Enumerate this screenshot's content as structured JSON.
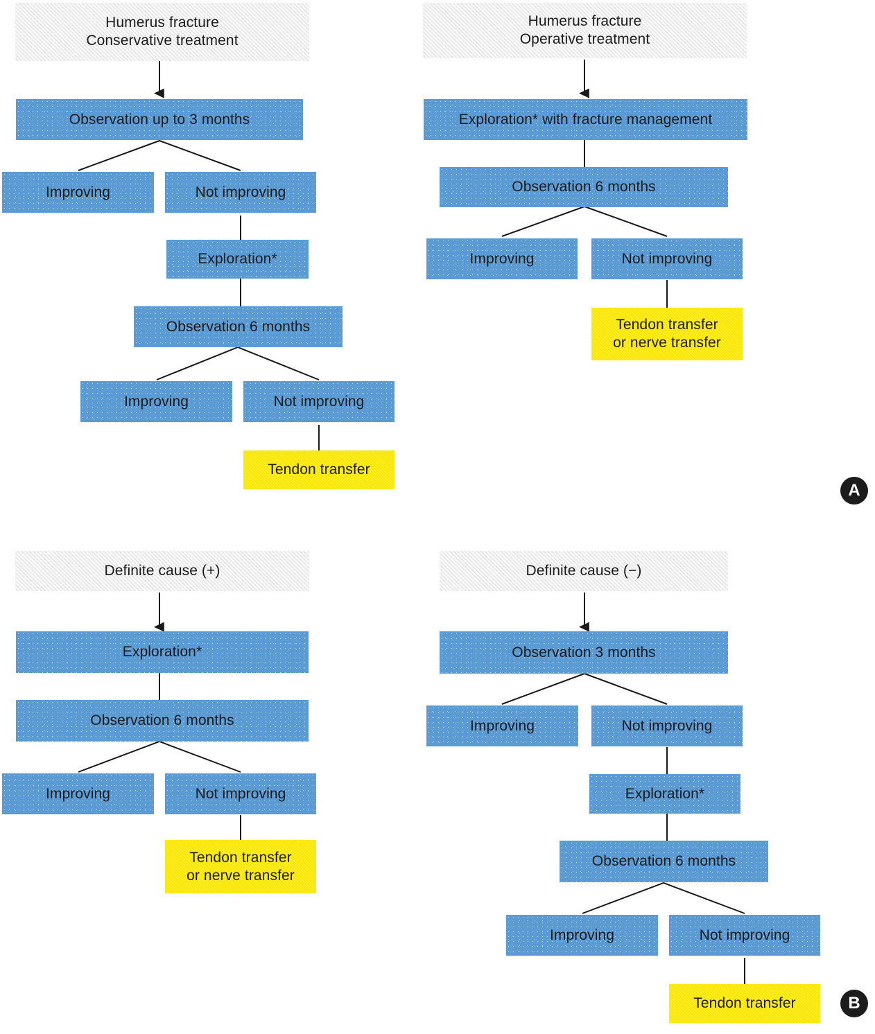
{
  "figure": {
    "panels": [
      {
        "tag": "A",
        "charts": [
          {
            "id": "a-left",
            "title": "Humerus fracture\nConservative treatment",
            "nodes": [
              {
                "id": "a1",
                "text": "Humerus fracture\nConservative treatment",
                "type": "header"
              },
              {
                "id": "a2",
                "text": "Observation up to 3 months",
                "type": "process"
              },
              {
                "id": "a3",
                "text": "Improving",
                "type": "process"
              },
              {
                "id": "a4",
                "text": "Not improving",
                "type": "process"
              },
              {
                "id": "a5",
                "text": "Exploration*",
                "type": "process"
              },
              {
                "id": "a6",
                "text": "Observation 6 months",
                "type": "process"
              },
              {
                "id": "a7",
                "text": "Improving",
                "type": "process"
              },
              {
                "id": "a8",
                "text": "Not improving",
                "type": "process"
              },
              {
                "id": "a9",
                "text": "Tendon transfer",
                "type": "outcome"
              }
            ]
          },
          {
            "id": "a-right",
            "title": "Humerus fracture\nOperative treatment",
            "nodes": [
              {
                "id": "b1",
                "text": "Humerus fracture\nOperative treatment",
                "type": "header"
              },
              {
                "id": "b2",
                "text": "Exploration* with fracture management",
                "type": "process"
              },
              {
                "id": "b3",
                "text": "Observation 6 months",
                "type": "process"
              },
              {
                "id": "b4",
                "text": "Improving",
                "type": "process"
              },
              {
                "id": "b5",
                "text": "Not improving",
                "type": "process"
              },
              {
                "id": "b6",
                "text": "Tendon transfer\nor nerve transfer",
                "type": "outcome"
              }
            ]
          }
        ]
      },
      {
        "tag": "B",
        "charts": [
          {
            "id": "b-left",
            "title": "Definite cause (+)",
            "nodes": [
              {
                "id": "c1",
                "text": "Definite cause (+)",
                "type": "header"
              },
              {
                "id": "c2",
                "text": "Exploration*",
                "type": "process"
              },
              {
                "id": "c3",
                "text": "Observation 6 months",
                "type": "process"
              },
              {
                "id": "c4",
                "text": "Improving",
                "type": "process"
              },
              {
                "id": "c5",
                "text": "Not improving",
                "type": "process"
              },
              {
                "id": "c6",
                "text": "Tendon transfer\nor nerve transfer",
                "type": "outcome"
              }
            ]
          },
          {
            "id": "b-right",
            "title": "Definite cause (−)",
            "nodes": [
              {
                "id": "d1",
                "text": "Definite cause (−)",
                "type": "header"
              },
              {
                "id": "d2",
                "text": "Observation 3 months",
                "type": "process"
              },
              {
                "id": "d3",
                "text": "Improving",
                "type": "process"
              },
              {
                "id": "d4",
                "text": "Not improving",
                "type": "process"
              },
              {
                "id": "d5",
                "text": "Exploration*",
                "type": "process"
              },
              {
                "id": "d6",
                "text": "Observation 6 months",
                "type": "process"
              },
              {
                "id": "d7",
                "text": "Improving",
                "type": "process"
              },
              {
                "id": "d8",
                "text": "Not improving",
                "type": "process"
              },
              {
                "id": "d9",
                "text": "Tendon transfer",
                "type": "outcome"
              }
            ]
          }
        ]
      }
    ],
    "panel_labels": {
      "a": "A",
      "b": "B"
    },
    "colors": {
      "process_blue": "#5b9bd5",
      "header_grey": "#ebebeb",
      "outcome_yellow": "#ffeb00",
      "connector_black": "#1a1a1a",
      "tag_black": "#1c1c1c",
      "text": "#1b1b1b"
    }
  }
}
